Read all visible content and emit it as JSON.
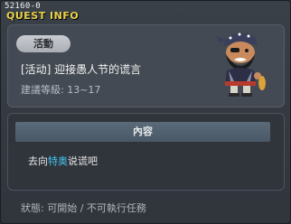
{
  "window": {
    "quest_id": "52160-0",
    "title": "QUEST INFO"
  },
  "quest": {
    "category_badge": "活動",
    "name": "[活动] 迎接愚人节的谎言",
    "level_requirement": "建議等級: 13~17"
  },
  "content": {
    "header": "內容",
    "task_prefix": "去向",
    "task_npc": "特奥",
    "task_suffix": "说谎吧"
  },
  "status": {
    "text": "狀態: 可開始 / 不可執行任務"
  },
  "colors": {
    "title": "#e9d24a",
    "npc_highlight": "#44c6f0",
    "panel_bg": "#444a53"
  }
}
